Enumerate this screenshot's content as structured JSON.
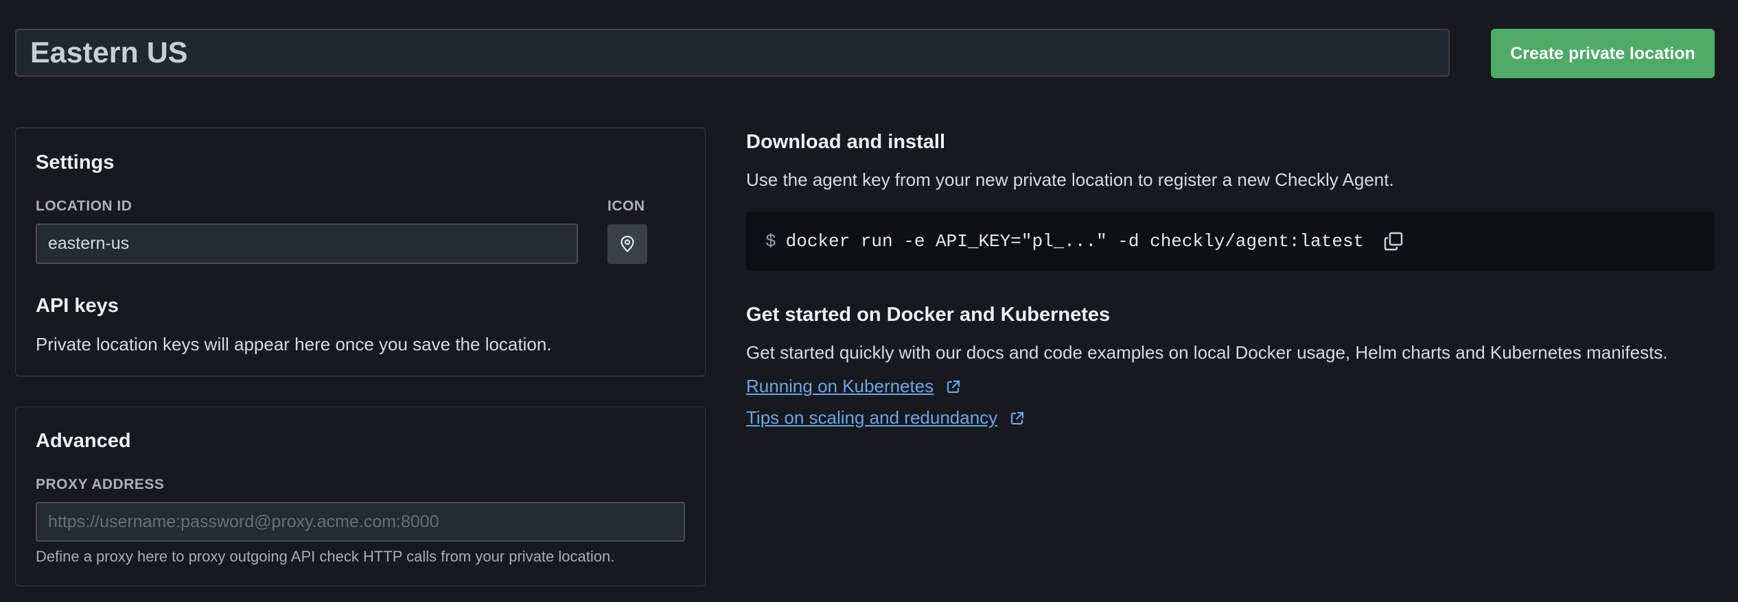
{
  "header": {
    "location_name": "Eastern US",
    "create_button": "Create private location"
  },
  "settings": {
    "title": "Settings",
    "location_id_label": "LOCATION ID",
    "location_id_value": "eastern-us",
    "icon_label": "ICON",
    "icon": "map-pin-icon",
    "api_keys_title": "API keys",
    "api_keys_text": "Private location keys will appear here once you save the location."
  },
  "advanced": {
    "title": "Advanced",
    "proxy_label": "PROXY ADDRESS",
    "proxy_placeholder": "https://username:password@proxy.acme.com:8000",
    "proxy_hint": "Define a proxy here to proxy outgoing API check HTTP calls from your private location."
  },
  "install": {
    "title": "Download and install",
    "description": "Use the agent key from your new private location to register a new Checkly Agent.",
    "prompt": "$",
    "command": "docker run -e API_KEY=\"pl_...\" -d checkly/agent:latest"
  },
  "docker": {
    "title": "Get started on Docker and Kubernetes",
    "description": "Get started quickly with our docs and code examples on local Docker usage, Helm charts and Kubernetes manifests.",
    "links": [
      {
        "label": "Running on Kubernetes"
      },
      {
        "label": "Tips on scaling and redundancy"
      }
    ]
  },
  "colors": {
    "background": "#17191e",
    "accent_green": "#4daa67",
    "link_blue": "#6aa5e6"
  }
}
